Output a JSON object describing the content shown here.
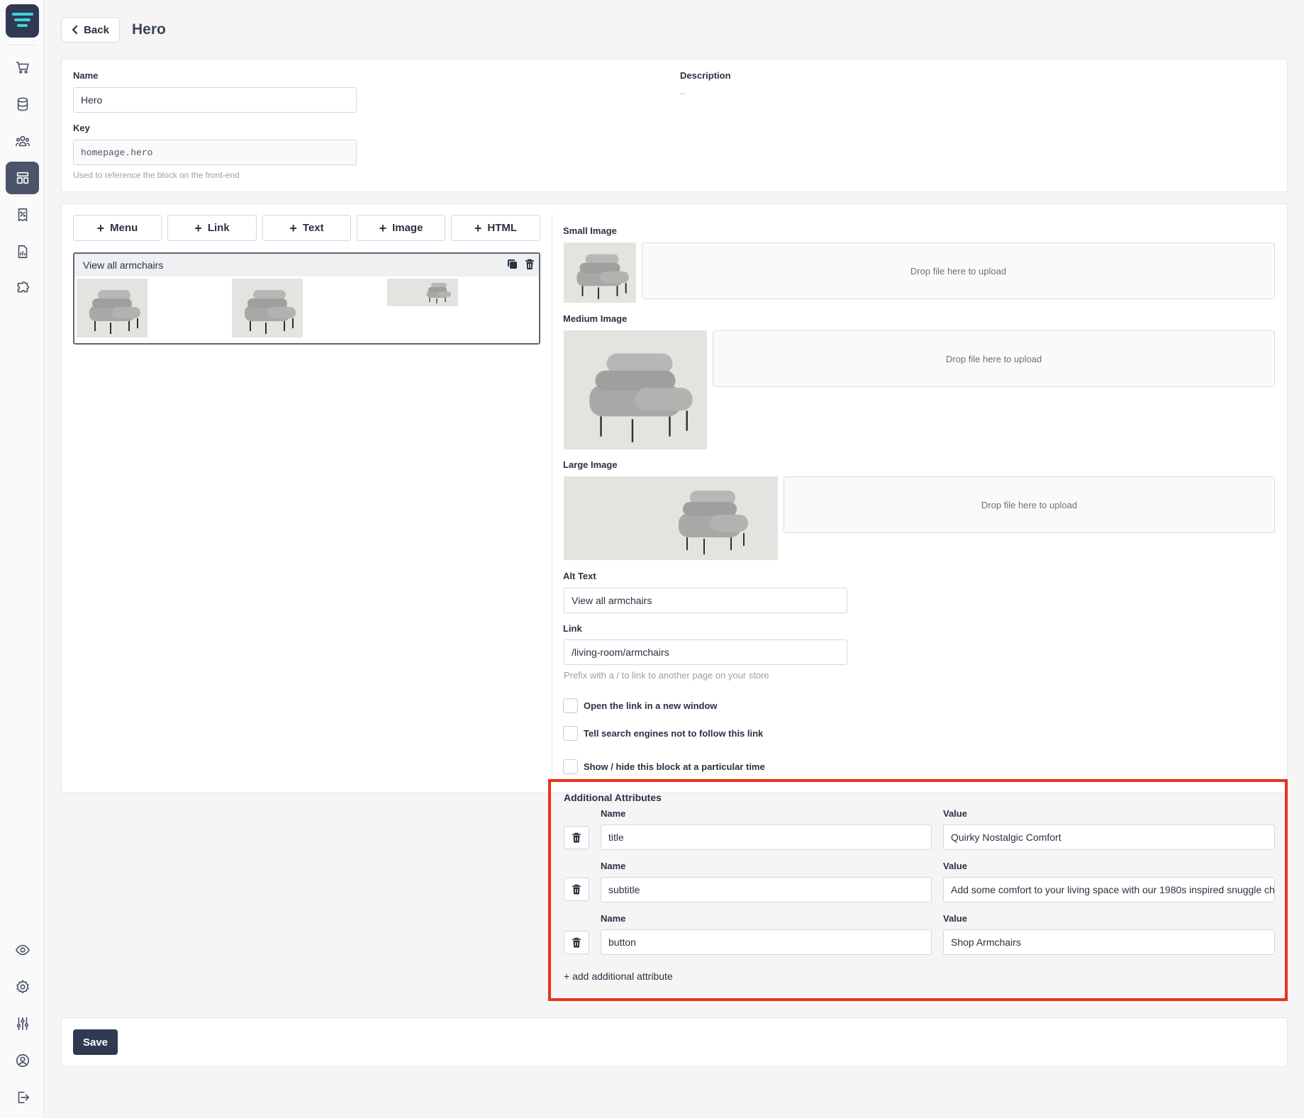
{
  "header": {
    "back_label": "Back",
    "title": "Hero"
  },
  "details": {
    "name_label": "Name",
    "name_value": "Hero",
    "description_label": "Description",
    "description_value": "–",
    "key_label": "Key",
    "key_value": "homepage.hero",
    "key_hint": "Used to reference the block on the front-end"
  },
  "toolbar": {
    "buttons": [
      {
        "label": "Menu"
      },
      {
        "label": "Link"
      },
      {
        "label": "Text"
      },
      {
        "label": "Image"
      },
      {
        "label": "HTML"
      }
    ]
  },
  "block": {
    "title": "View all armchairs"
  },
  "images": {
    "small_label": "Small Image",
    "medium_label": "Medium Image",
    "large_label": "Large Image",
    "drop_text": "Drop file here to upload"
  },
  "alt": {
    "label": "Alt Text",
    "value": "View all armchairs"
  },
  "link": {
    "label": "Link",
    "value": "/living-room/armchairs",
    "hint": "Prefix with a / to link to another page on your store"
  },
  "options": [
    {
      "label": "Open the link in a new window"
    },
    {
      "label": "Tell search engines not to follow this link"
    },
    {
      "label": "Show / hide this block at a particular time"
    }
  ],
  "attributes": {
    "title": "Additional Attributes",
    "name_label": "Name",
    "value_label": "Value",
    "rows": [
      {
        "name": "title",
        "value": "Quirky Nostalgic Comfort"
      },
      {
        "name": "subtitle",
        "value": "Add some comfort to your living space with our 1980s inspired snuggle ch"
      },
      {
        "name": "button",
        "value": "Shop Armchairs"
      }
    ],
    "add_label": "+ add additional attribute"
  },
  "footer": {
    "save_label": "Save"
  },
  "icons": {
    "sidebar": [
      "cart-icon",
      "database-icon",
      "users-icon",
      "layout-icon",
      "discount-icon",
      "report-icon",
      "puzzle-icon",
      "eye-icon",
      "settings-icon",
      "sliders-icon",
      "account-icon",
      "logout-icon"
    ]
  },
  "colors": {
    "brand": "#2f3a52",
    "accent": "#3fd3d9",
    "highlight": "#e8321e"
  }
}
